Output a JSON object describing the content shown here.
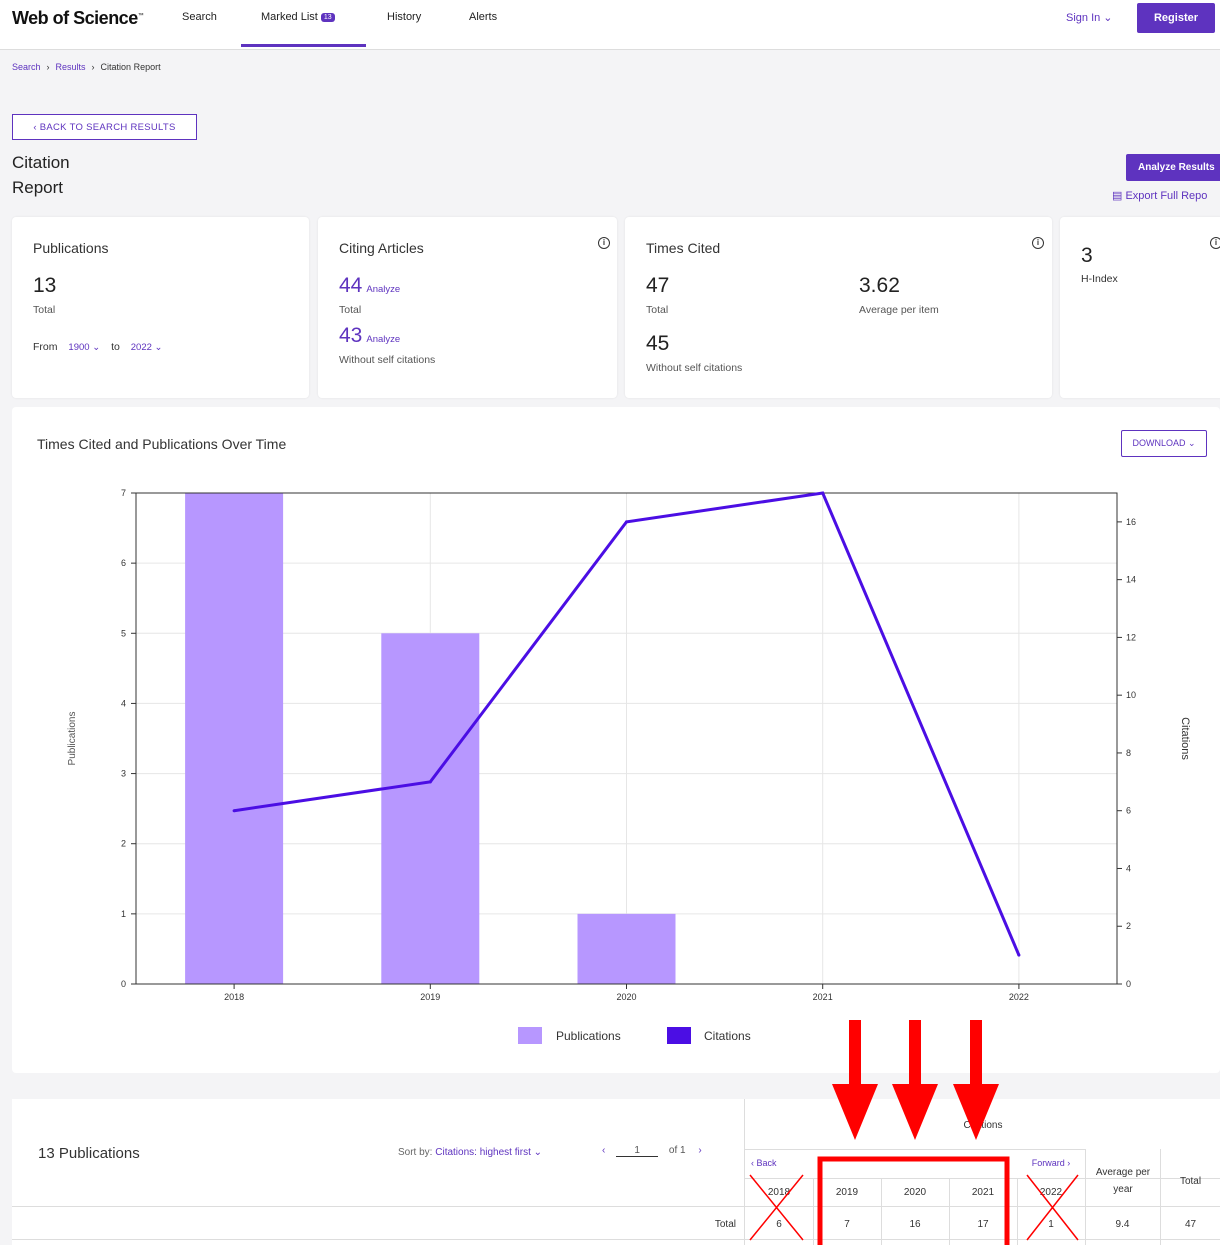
{
  "header": {
    "logo": "Web of Science",
    "logo_tm": "™",
    "nav": [
      "Search",
      "Marked List",
      "History",
      "Alerts"
    ],
    "marked_count": "13",
    "sign_in": "Sign In ⌄",
    "register": "Register"
  },
  "breadcrumb": {
    "search": "Search",
    "results": "Results",
    "current": "Citation Report"
  },
  "back_button": "‹ BACK TO SEARCH RESULTS",
  "page_title": "Citation Report",
  "analyze_results": "Analyze Results",
  "export_full_report": "Export Full Repo",
  "cards": {
    "publications": {
      "title": "Publications",
      "value": "13",
      "total_label": "Total",
      "from_label": "From",
      "from_year": "1900 ⌄",
      "to_label": "to",
      "to_year": "2022 ⌄"
    },
    "citing": {
      "title": "Citing Articles",
      "value": "44",
      "analyze": "Analyze",
      "total_label": "Total",
      "value2": "43",
      "analyze2": "Analyze",
      "without_label": "Without self citations"
    },
    "times_cited": {
      "title": "Times Cited",
      "value": "47",
      "total_label": "Total",
      "avg": "3.62",
      "avg_label": "Average per item",
      "value2": "45",
      "without_label": "Without self citations"
    },
    "h_index": {
      "value": "3",
      "label": "H-Index"
    }
  },
  "chart_section": {
    "title": "Times Cited and Publications Over Time",
    "download": "DOWNLOAD ⌄"
  },
  "chart_data": {
    "type": "bar",
    "categories": [
      "2018",
      "2019",
      "2020",
      "2021",
      "2022"
    ],
    "series": [
      {
        "name": "Publications",
        "type": "bar",
        "axis": "left",
        "values": [
          7,
          5,
          1,
          0,
          0
        ],
        "color": "#b797ff"
      },
      {
        "name": "Citations",
        "type": "line",
        "axis": "right",
        "values": [
          6,
          7,
          16,
          17,
          1
        ],
        "color": "#4b0ee4"
      }
    ],
    "ylabel": "Publications",
    "y2label": "Citations",
    "ylim": [
      0,
      7
    ],
    "y2lim": [
      0,
      17
    ],
    "yticks": [
      0,
      1,
      2,
      3,
      4,
      5,
      6,
      7
    ],
    "y2ticks": [
      0,
      2,
      4,
      6,
      8,
      10,
      12,
      14,
      16
    ],
    "grid": true,
    "legend": "bottom-center"
  },
  "table": {
    "pubs_count": "13 Publications",
    "sort_label": "Sort by:",
    "sort_value": "Citations: highest first ⌄",
    "page": "1",
    "of": "of 1",
    "citations_header": "Citations",
    "back": "‹ Back",
    "forward": "Forward ›",
    "years": [
      "2018",
      "2019",
      "2020",
      "2021",
      "2022"
    ],
    "avg_header": "Average per year",
    "total_header": "Total",
    "total_row_label": "Total",
    "total_row": [
      "6",
      "7",
      "16",
      "17",
      "1"
    ],
    "total_avg": "9.4",
    "total_total": "47"
  },
  "colors": {
    "accent": "#5e33bf",
    "annotation": "#ff0000"
  }
}
